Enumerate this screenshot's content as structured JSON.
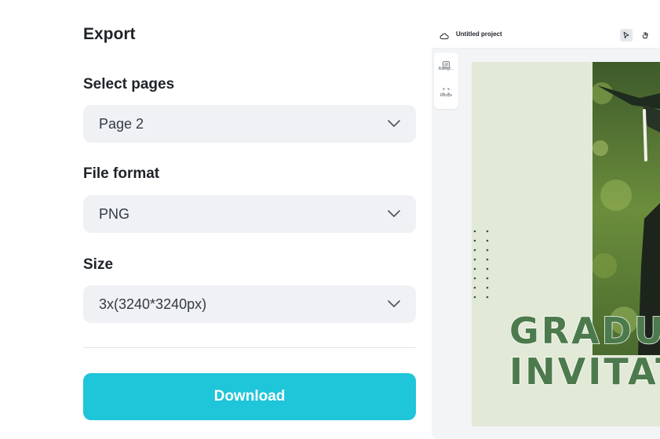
{
  "export": {
    "title": "Export",
    "select_pages": {
      "label": "Select pages",
      "value": "Page 2"
    },
    "file_format": {
      "label": "File format",
      "value": "PNG"
    },
    "size": {
      "label": "Size",
      "value": "3x(3240*3240px)"
    },
    "download_label": "Download"
  },
  "editor": {
    "project_title": "Untitled project",
    "toolbar_icons": [
      "cloud-icon",
      "pointer-icon",
      "hand-icon"
    ],
    "side_items": [
      {
        "label": "Backgr...",
        "icon": "background-icon"
      },
      {
        "label": "Resize",
        "icon": "resize-icon"
      }
    ],
    "design": {
      "line1": "GRADUA",
      "line2": "INVITAT"
    }
  },
  "colors": {
    "accent": "#1fc5d9",
    "field_bg": "#eff1f4",
    "design_bg": "#e2e9d6",
    "design_text": "#4c7a4c"
  }
}
